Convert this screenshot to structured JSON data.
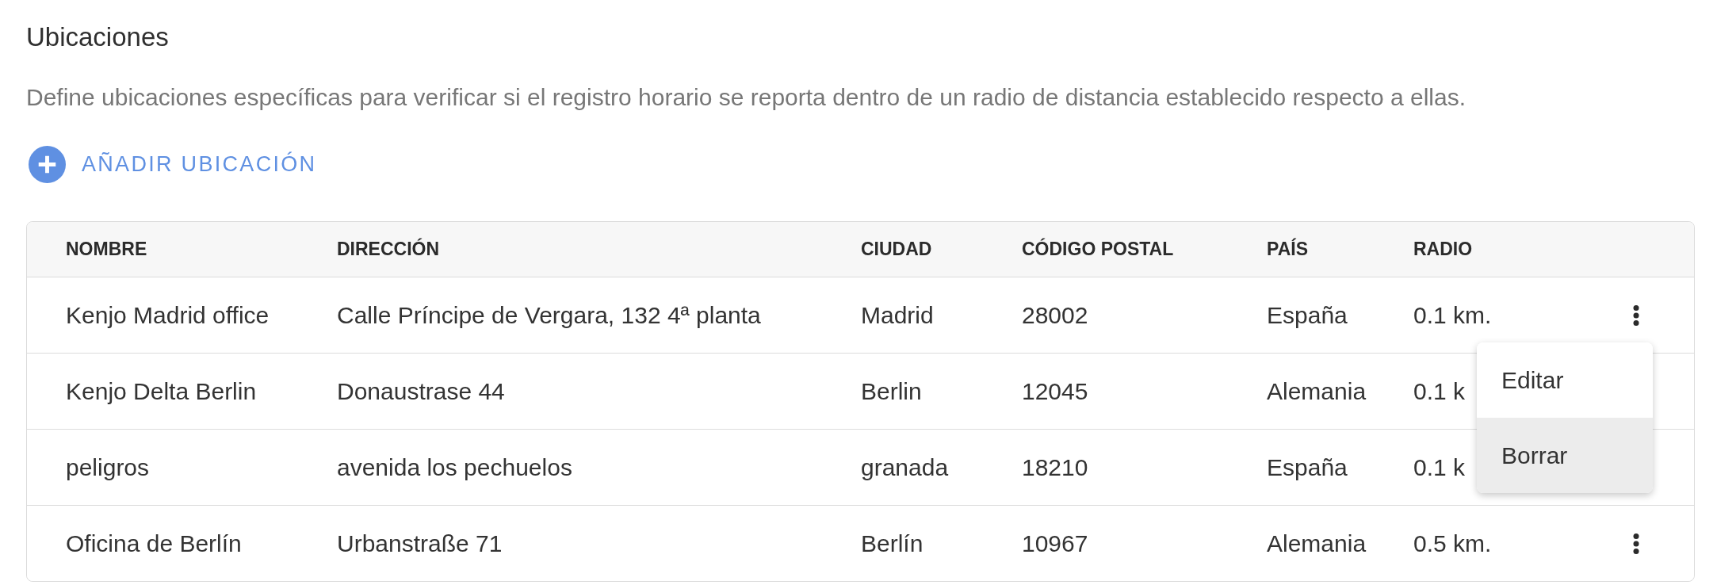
{
  "section": {
    "title": "Ubicaciones",
    "description": "Define ubicaciones específicas para verificar si el registro horario se reporta dentro de un radio de distancia establecido respecto a ellas."
  },
  "add_button": {
    "label": "AÑADIR UBICACIÓN"
  },
  "table": {
    "columns": [
      "NOMBRE",
      "DIRECCIÓN",
      "CIUDAD",
      "CÓDIGO POSTAL",
      "PAÍS",
      "RADIO"
    ],
    "rows": [
      {
        "cells": [
          "Kenjo Madrid office",
          "Calle Príncipe de Vergara, 132 4ª planta",
          "Madrid",
          "28002",
          "España",
          "0.1 km."
        ],
        "menu_open": true
      },
      {
        "cells": [
          "Kenjo Delta Berlin",
          "Donaustrase 44",
          "Berlin",
          "12045",
          "Alemania",
          "0.1 k"
        ],
        "menu_open": false
      },
      {
        "cells": [
          "peligros",
          "avenida los pechuelos",
          "granada",
          "18210",
          "España",
          "0.1 k"
        ],
        "menu_open": false
      },
      {
        "cells": [
          "Oficina de Berlín",
          "Urbanstraße 71",
          "Berlín",
          "10967",
          "Alemania",
          "0.5 km."
        ],
        "menu_open": false
      }
    ]
  },
  "context_menu": {
    "items": [
      {
        "label": "Editar",
        "selected": false
      },
      {
        "label": "Borrar",
        "selected": true
      }
    ]
  }
}
